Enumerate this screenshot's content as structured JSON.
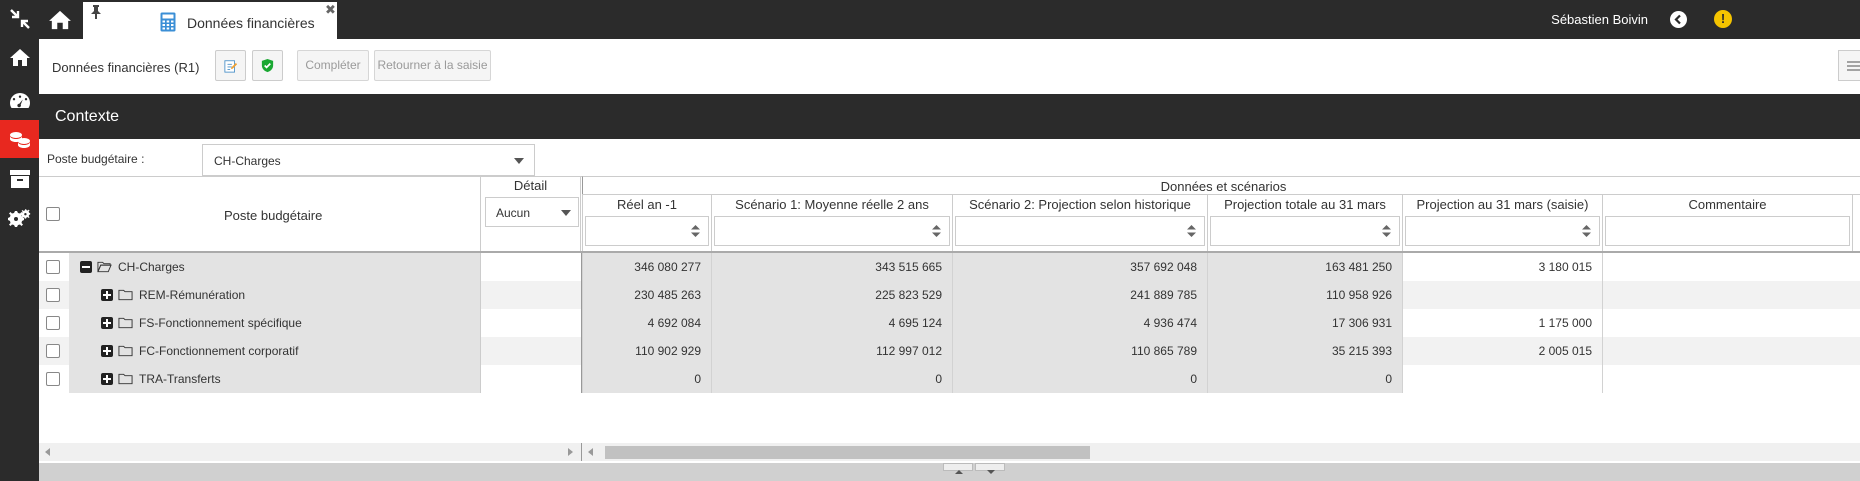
{
  "topbar": {
    "tab_label": "Données financières",
    "user_name": "Sébastien Boivin"
  },
  "toolbar": {
    "doc_title": "Données financières (R1)",
    "complete_label": "Compléter",
    "return_label": "Retourner à la saisie"
  },
  "section": {
    "title": "Contexte"
  },
  "filter": {
    "label": "Poste budgétaire :",
    "value": "CH-Charges"
  },
  "grid": {
    "poste_header": "Poste budgétaire",
    "detail_header": "Détail",
    "detail_value": "Aucun",
    "group_header": "Données et scénarios",
    "columns": [
      "Réel an -1",
      "Scénario 1: Moyenne réelle 2 ans",
      "Scénario 2: Projection selon historique",
      "Projection totale au 31 mars",
      "Projection au 31 mars (saisie)",
      "Commentaire"
    ],
    "rows": [
      {
        "label": "CH-Charges",
        "level": 0,
        "expanded": true,
        "values": [
          "346 080 277",
          "343 515 665",
          "357 692 048",
          "163 481 250",
          "3 180 015",
          ""
        ]
      },
      {
        "label": "REM-Rémunération",
        "level": 1,
        "expanded": false,
        "values": [
          "230 485 263",
          "225 823 529",
          "241 889 785",
          "110 958 926",
          "",
          ""
        ]
      },
      {
        "label": "FS-Fonctionnement spécifique",
        "level": 1,
        "expanded": false,
        "values": [
          "4 692 084",
          "4 695 124",
          "4 936 474",
          "17 306 931",
          "1 175 000",
          ""
        ]
      },
      {
        "label": "FC-Fonctionnement corporatif",
        "level": 1,
        "expanded": false,
        "values": [
          "110 902 929",
          "112 997 012",
          "110 865 789",
          "35 215 393",
          "2 005 015",
          ""
        ]
      },
      {
        "label": "TRA-Transferts",
        "level": 1,
        "expanded": false,
        "values": [
          "0",
          "0",
          "0",
          "0",
          "",
          ""
        ]
      }
    ]
  },
  "colors": {
    "dark": "#2b2b2b",
    "active_nav": "#e8281f",
    "warning": "#f5c400",
    "readonly_cell": "#e3e3e3"
  },
  "icons": [
    "collapse-icon",
    "home-icon",
    "dashboard-icon",
    "budget-icon",
    "archive-icon",
    "settings-icon",
    "pin-icon",
    "calculator-icon",
    "back-icon",
    "warning-icon",
    "edit-icon",
    "shield-icon",
    "folder-icon"
  ]
}
